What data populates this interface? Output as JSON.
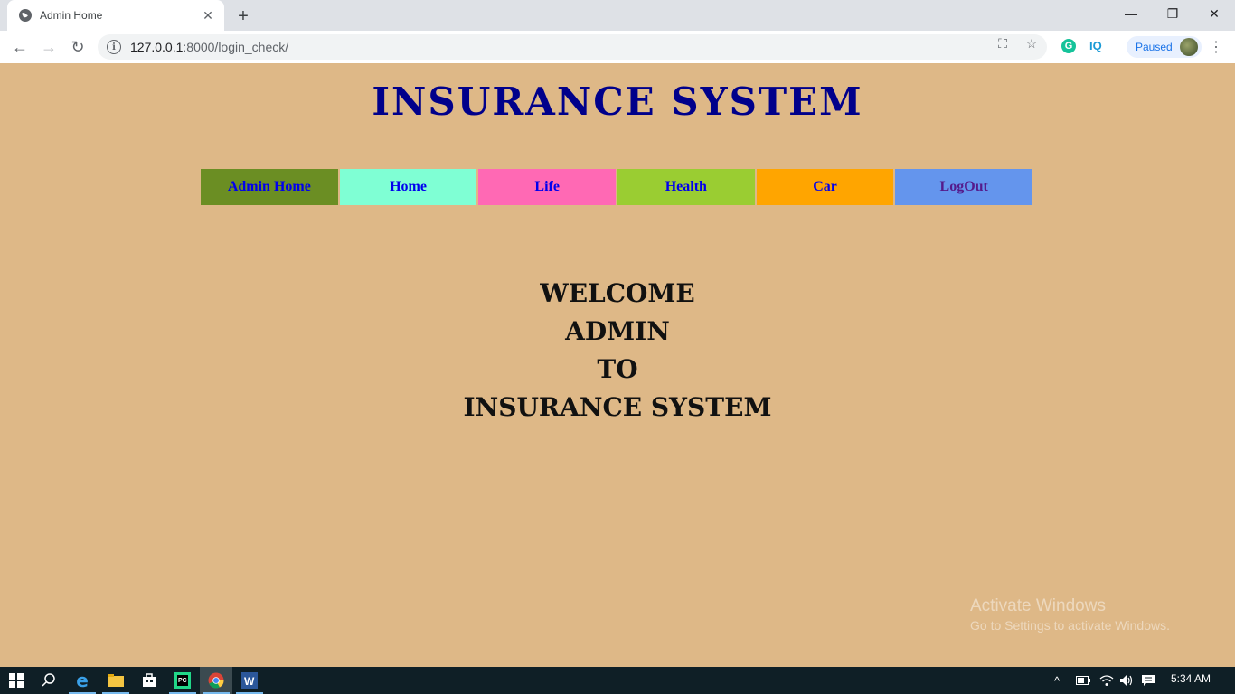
{
  "browser": {
    "tab_title": "Admin Home",
    "new_tab_label": "+",
    "url_host": "127.0.0.1",
    "url_rest": ":8000/login_check/",
    "profile_status": "Paused",
    "window_controls": [
      "minimize-icon",
      "restore-icon",
      "close-icon"
    ]
  },
  "page": {
    "title": "INSURANCE SYSTEM",
    "nav": [
      {
        "label": "Admin Home",
        "color": "#6b8e23"
      },
      {
        "label": "Home",
        "color": "#7fffd4"
      },
      {
        "label": "Life",
        "color": "#ff69b4"
      },
      {
        "label": "Health",
        "color": "#9acd32"
      },
      {
        "label": "Car",
        "color": "#ffa500"
      },
      {
        "label": "LogOut",
        "color": "#6495ed"
      }
    ],
    "welcome_lines": [
      "WELCOME",
      "ADMIN",
      "TO",
      "INSURANCE SYSTEM"
    ],
    "background_color": "#deb887",
    "title_color": "#00008b"
  },
  "watermark": {
    "line1": "Activate Windows",
    "line2": "Go to Settings to activate Windows."
  },
  "taskbar": {
    "apps": [
      "windows-start-icon",
      "search-icon",
      "edge-icon",
      "file-explorer-icon",
      "store-icon",
      "pycharm-icon",
      "chrome-icon",
      "word-icon"
    ],
    "clock": "5:34 AM"
  }
}
